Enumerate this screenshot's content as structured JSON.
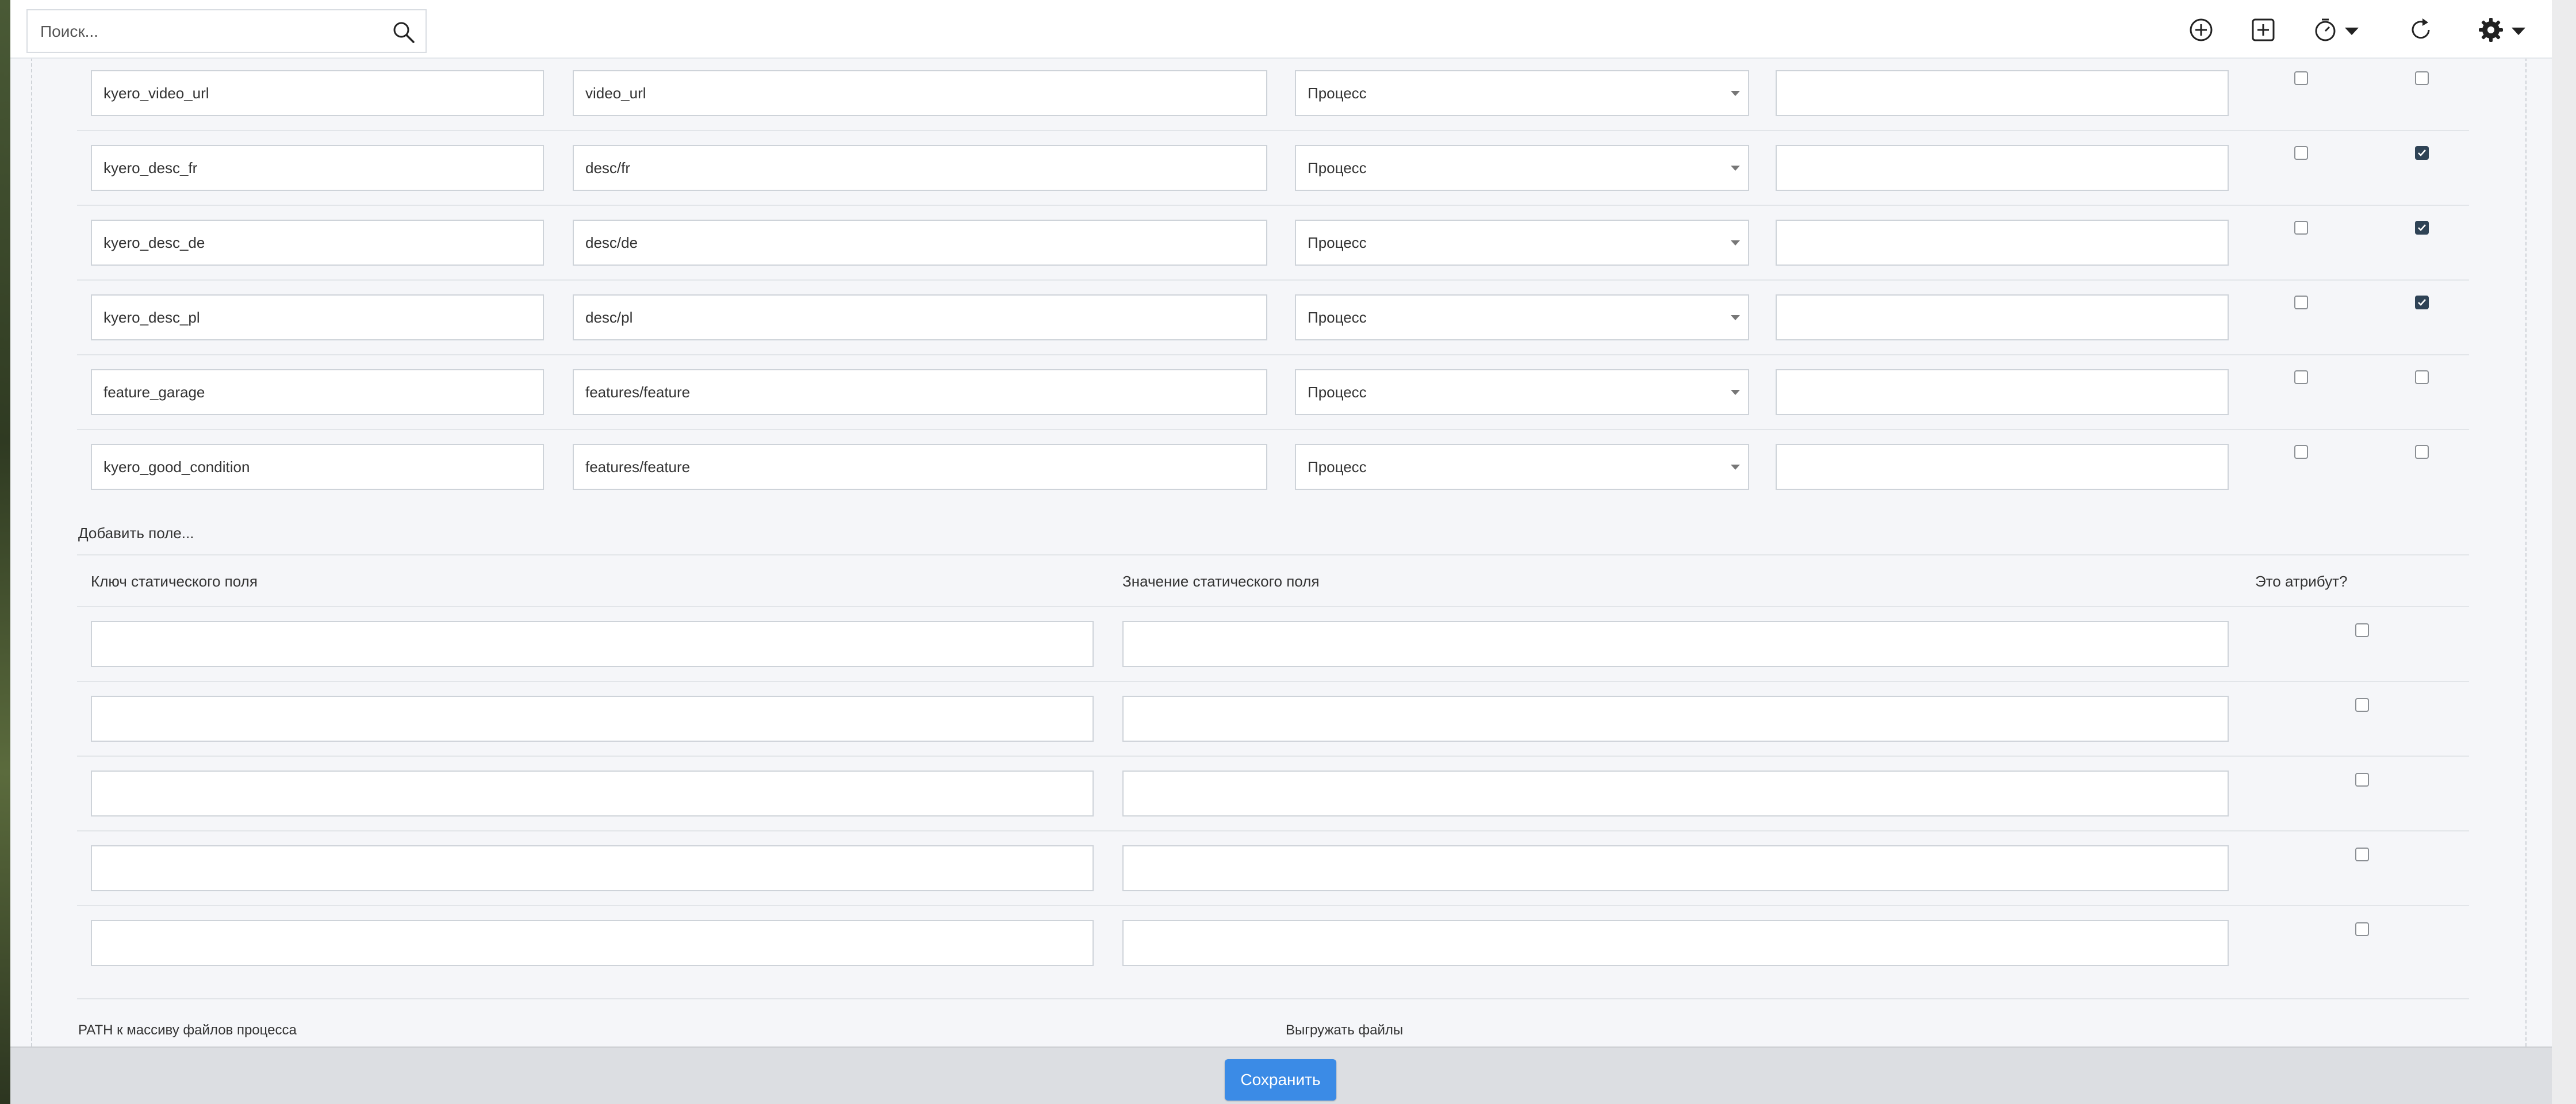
{
  "search": {
    "placeholder": "Поиск..."
  },
  "toolbar": {
    "icons": [
      "plus-circle-icon",
      "plus-square-icon",
      "timer-icon",
      "refresh-icon",
      "gear-icon"
    ]
  },
  "mapping_rows": [
    {
      "key": "kyero_video_url",
      "path": "video_url",
      "type": "Процесс",
      "extra": "",
      "check1": false,
      "check2": false
    },
    {
      "key": "kyero_desc_fr",
      "path": "desc/fr",
      "type": "Процесс",
      "extra": "",
      "check1": false,
      "check2": true
    },
    {
      "key": "kyero_desc_de",
      "path": "desc/de",
      "type": "Процесс",
      "extra": "",
      "check1": false,
      "check2": true
    },
    {
      "key": "kyero_desc_pl",
      "path": "desc/pl",
      "type": "Процесс",
      "extra": "",
      "check1": false,
      "check2": true
    },
    {
      "key": "feature_garage",
      "path": "features/feature",
      "type": "Процесс",
      "extra": "",
      "check1": false,
      "check2": false
    },
    {
      "key": "kyero_good_condition",
      "path": "features/feature",
      "type": "Процесс",
      "extra": "",
      "check1": false,
      "check2": false
    }
  ],
  "add_field_link": "Добавить поле...",
  "static_fields": {
    "headers": {
      "key": "Ключ статического поля",
      "value": "Значение статического поля",
      "is_attribute": "Это атрибут?"
    },
    "rows": [
      {
        "key": "",
        "value": "",
        "is_attribute": false
      },
      {
        "key": "",
        "value": "",
        "is_attribute": false
      },
      {
        "key": "",
        "value": "",
        "is_attribute": false
      },
      {
        "key": "",
        "value": "",
        "is_attribute": false
      },
      {
        "key": "",
        "value": "",
        "is_attribute": false
      }
    ]
  },
  "bottom_labels": {
    "path_label": "PATH к массиву файлов процесса",
    "upload_label": "Выгружать файлы"
  },
  "footer": {
    "save_label": "Сохранить"
  }
}
